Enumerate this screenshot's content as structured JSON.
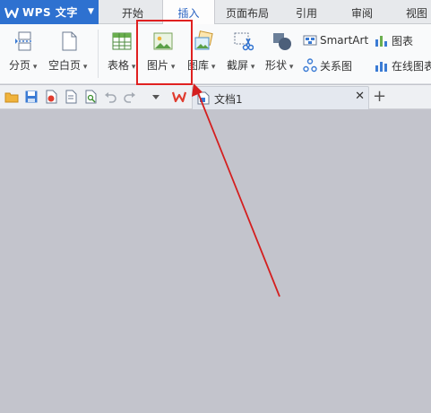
{
  "app": {
    "title": "WPS 文字"
  },
  "tabs": [
    {
      "label": "开始"
    },
    {
      "label": "插入"
    },
    {
      "label": "页面布局"
    },
    {
      "label": "引用"
    },
    {
      "label": "审阅"
    },
    {
      "label": "视图"
    }
  ],
  "active_tab": "插入",
  "ribbon": {
    "page_break": "分页",
    "blank_page": "空白页",
    "table": "表格",
    "picture": "图片",
    "gallery": "图库",
    "screenshot": "截屏",
    "shapes": "形状",
    "smartart": "SmartArt",
    "relation_diagram": "关系图",
    "chart": "图表",
    "online_chart": "在线图表"
  },
  "document": {
    "tab_name": "文档1"
  },
  "colors": {
    "brand_blue": "#2e71d0",
    "annotation_red": "#e02020",
    "workspace_gray": "#c3c4cc"
  }
}
